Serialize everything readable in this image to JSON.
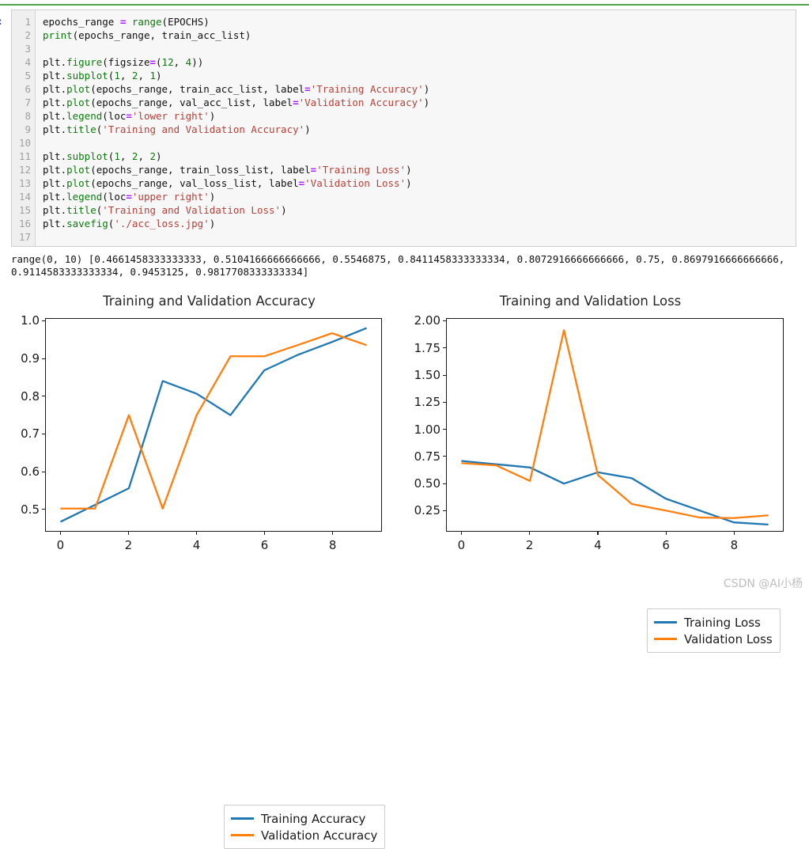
{
  "notebook": {
    "cell_prompt": "]:",
    "code_lines": [
      {
        "n": "1",
        "text": "epochs_range = range(EPOCHS)"
      },
      {
        "n": "2",
        "text": "print(epochs_range, train_acc_list)"
      },
      {
        "n": "3",
        "text": ""
      },
      {
        "n": "4",
        "text": "plt.figure(figsize=(12, 4))"
      },
      {
        "n": "5",
        "text": "plt.subplot(1, 2, 1)"
      },
      {
        "n": "6",
        "text": "plt.plot(epochs_range, train_acc_list, label='Training Accuracy')"
      },
      {
        "n": "7",
        "text": "plt.plot(epochs_range, val_acc_list, label='Validation Accuracy')"
      },
      {
        "n": "8",
        "text": "plt.legend(loc='lower right')"
      },
      {
        "n": "9",
        "text": "plt.title('Training and Validation Accuracy')"
      },
      {
        "n": "10",
        "text": ""
      },
      {
        "n": "11",
        "text": "plt.subplot(1, 2, 2)"
      },
      {
        "n": "12",
        "text": "plt.plot(epochs_range, train_loss_list, label='Training Loss')"
      },
      {
        "n": "13",
        "text": "plt.plot(epochs_range, val_loss_list, label='Validation Loss')"
      },
      {
        "n": "14",
        "text": "plt.legend(loc='upper right')"
      },
      {
        "n": "15",
        "text": "plt.title('Training and Validation Loss')"
      },
      {
        "n": "16",
        "text": "plt.savefig('./acc_loss.jpg')"
      },
      {
        "n": "17",
        "text": ""
      }
    ],
    "stdout": "range(0, 10) [0.4661458333333333, 0.5104166666666666, 0.5546875, 0.8411458333333334, 0.8072916666666666, 0.75, 0.8697916666666666, 0.9114583333333334, 0.9453125, 0.9817708333333334]",
    "watermark": "CSDN @AI小杨"
  },
  "colors": {
    "train": "#1f77b4",
    "validation": "#ff7f0e",
    "axis": "#1a1a1a",
    "rule_green": "#4ba34b",
    "cell_bg": "#f7f7f7"
  },
  "chart_data": [
    {
      "type": "line",
      "title": "Training and Validation Accuracy",
      "xlabel": "",
      "ylabel": "",
      "x": [
        0,
        1,
        2,
        3,
        4,
        5,
        6,
        7,
        8,
        9
      ],
      "xlim": [
        -0.45,
        9.45
      ],
      "ylim": [
        0.4409,
        1.0071
      ],
      "xticks": [
        0,
        2,
        4,
        6,
        8
      ],
      "xticklabels": [
        "0",
        "2",
        "4",
        "6",
        "8"
      ],
      "yticks": [
        0.5,
        0.6,
        0.7,
        0.8,
        0.9,
        1.0
      ],
      "yticklabels": [
        "0.5",
        "0.6",
        "0.7",
        "0.8",
        "0.9",
        "1.0"
      ],
      "grid": false,
      "legend_position": "lower right",
      "series": [
        {
          "name": "Training Accuracy",
          "color": "#1f77b4",
          "values": [
            0.4661458333333333,
            0.5104166666666666,
            0.5546875,
            0.8411458333333334,
            0.8072916666666666,
            0.75,
            0.8697916666666666,
            0.9114583333333334,
            0.9453125,
            0.9817708333333334
          ]
        },
        {
          "name": "Validation Accuracy",
          "color": "#ff7f0e",
          "values": [
            0.5005,
            0.5005,
            0.75,
            0.5005,
            0.75,
            0.9072,
            0.9072,
            0.9375,
            0.9688,
            0.9375
          ]
        }
      ]
    },
    {
      "type": "line",
      "title": "Training and Validation Loss",
      "xlabel": "",
      "ylabel": "",
      "x": [
        0,
        1,
        2,
        3,
        4,
        5,
        6,
        7,
        8,
        9
      ],
      "xlim": [
        -0.45,
        9.45
      ],
      "ylim": [
        0.0555,
        2.0255
      ],
      "xticks": [
        0,
        2,
        4,
        6,
        8
      ],
      "xticklabels": [
        "0",
        "2",
        "4",
        "6",
        "8"
      ],
      "yticks": [
        0.25,
        0.5,
        0.75,
        1.0,
        1.25,
        1.5,
        1.75,
        2.0
      ],
      "yticklabels": [
        "0.25",
        "0.50",
        "0.75",
        "1.00",
        "1.25",
        "1.50",
        "1.75",
        "2.00"
      ],
      "grid": false,
      "legend_position": "upper right",
      "series": [
        {
          "name": "Training Loss",
          "color": "#1f77b4",
          "values": [
            0.705,
            0.675,
            0.645,
            0.495,
            0.6,
            0.545,
            0.355,
            0.245,
            0.135,
            0.115
          ]
        },
        {
          "name": "Validation Loss",
          "color": "#ff7f0e",
          "values": [
            0.685,
            0.665,
            0.52,
            1.92,
            0.575,
            0.305,
            0.245,
            0.18,
            0.175,
            0.2
          ]
        }
      ]
    }
  ]
}
